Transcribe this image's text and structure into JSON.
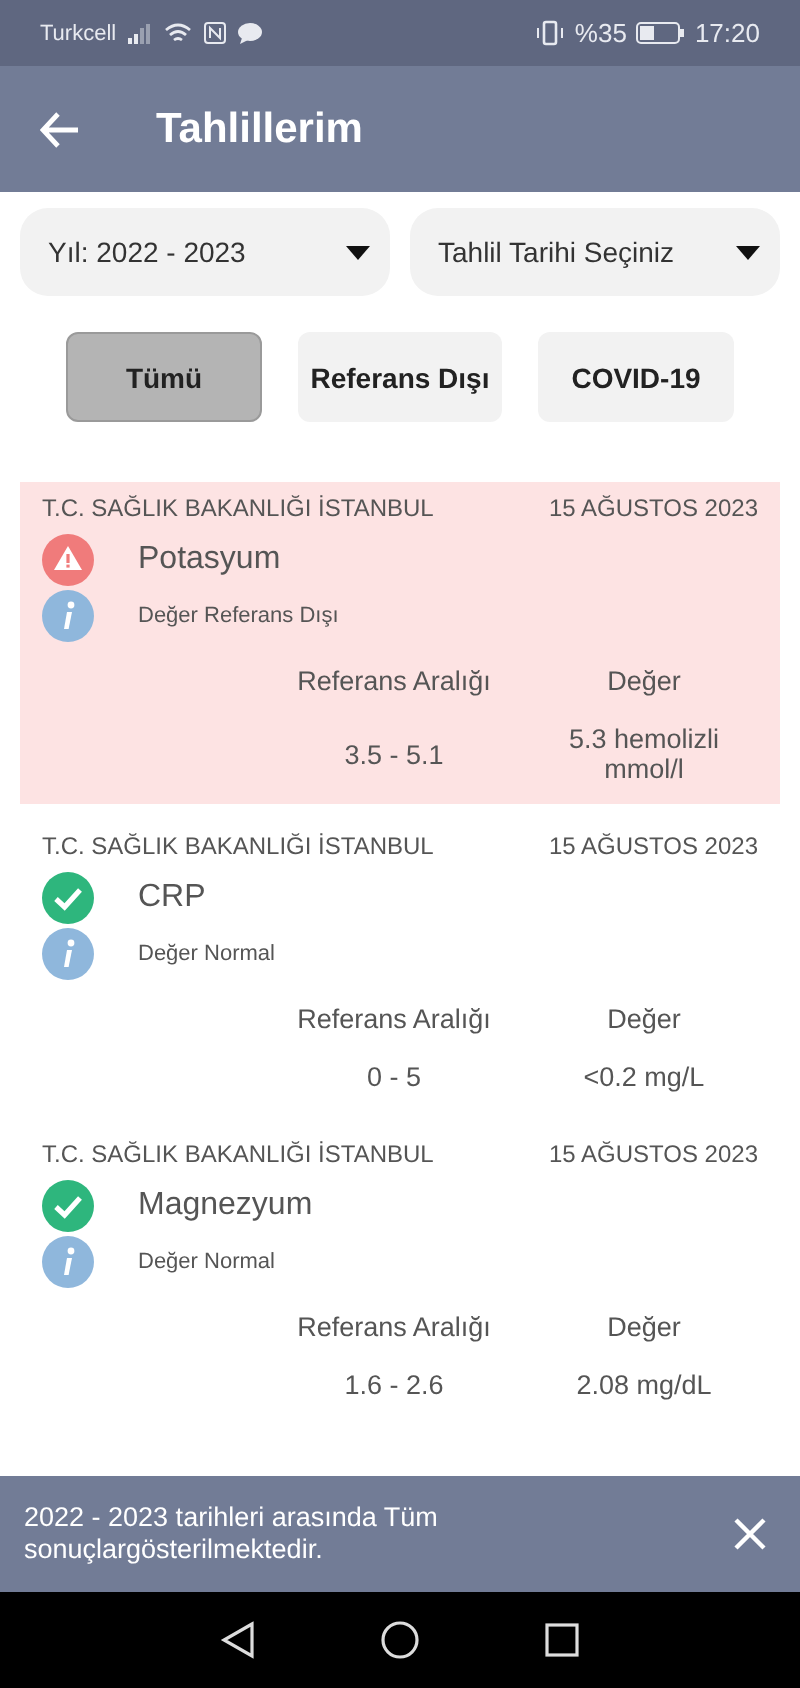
{
  "status_bar": {
    "carrier": "Turkcell",
    "battery": "%35",
    "time": "17:20"
  },
  "app_bar": {
    "title": "Tahlillerim"
  },
  "filters": [
    {
      "value": "Yıl: 2022 - 2023"
    },
    {
      "value": "Tahlil Tarihi Seçiniz"
    }
  ],
  "chips": [
    {
      "label": "Tümü",
      "selected": true
    },
    {
      "label": "Referans Dışı",
      "selected": false
    },
    {
      "label": "COVID-19",
      "selected": false
    }
  ],
  "results": [
    {
      "source": "T.C. SAĞLIK BAKANLIĞI İSTANBUL",
      "date": "15 AĞUSTOS 2023",
      "name": "Potasyum",
      "kind": "abnormal",
      "note": "Değer Referans Dışı",
      "range_label": "Referans Aralığı",
      "value_label": "Değer",
      "range": "3.5 - 5.1",
      "value": "5.3 hemolizli mmol/l"
    },
    {
      "source": "T.C. SAĞLIK BAKANLIĞI İSTANBUL",
      "date": "15 AĞUSTOS 2023",
      "name": "CRP",
      "kind": "normal",
      "note": "Değer Normal",
      "range_label": "Referans Aralığı",
      "value_label": "Değer",
      "range": "0 - 5",
      "value": "<0.2 mg/L"
    },
    {
      "source": "T.C. SAĞLIK BAKANLIĞI İSTANBUL",
      "date": "15 AĞUSTOS 2023",
      "name": "Magnezyum",
      "kind": "normal",
      "note": "Değer Normal",
      "range_label": "Referans Aralığı",
      "value_label": "Değer",
      "range": "1.6 - 2.6",
      "value": "2.08 mg/dL"
    }
  ],
  "snackbar": {
    "message": "2022 - 2023 tarihleri arasında Tüm sonuçlargösterilmektedir."
  }
}
